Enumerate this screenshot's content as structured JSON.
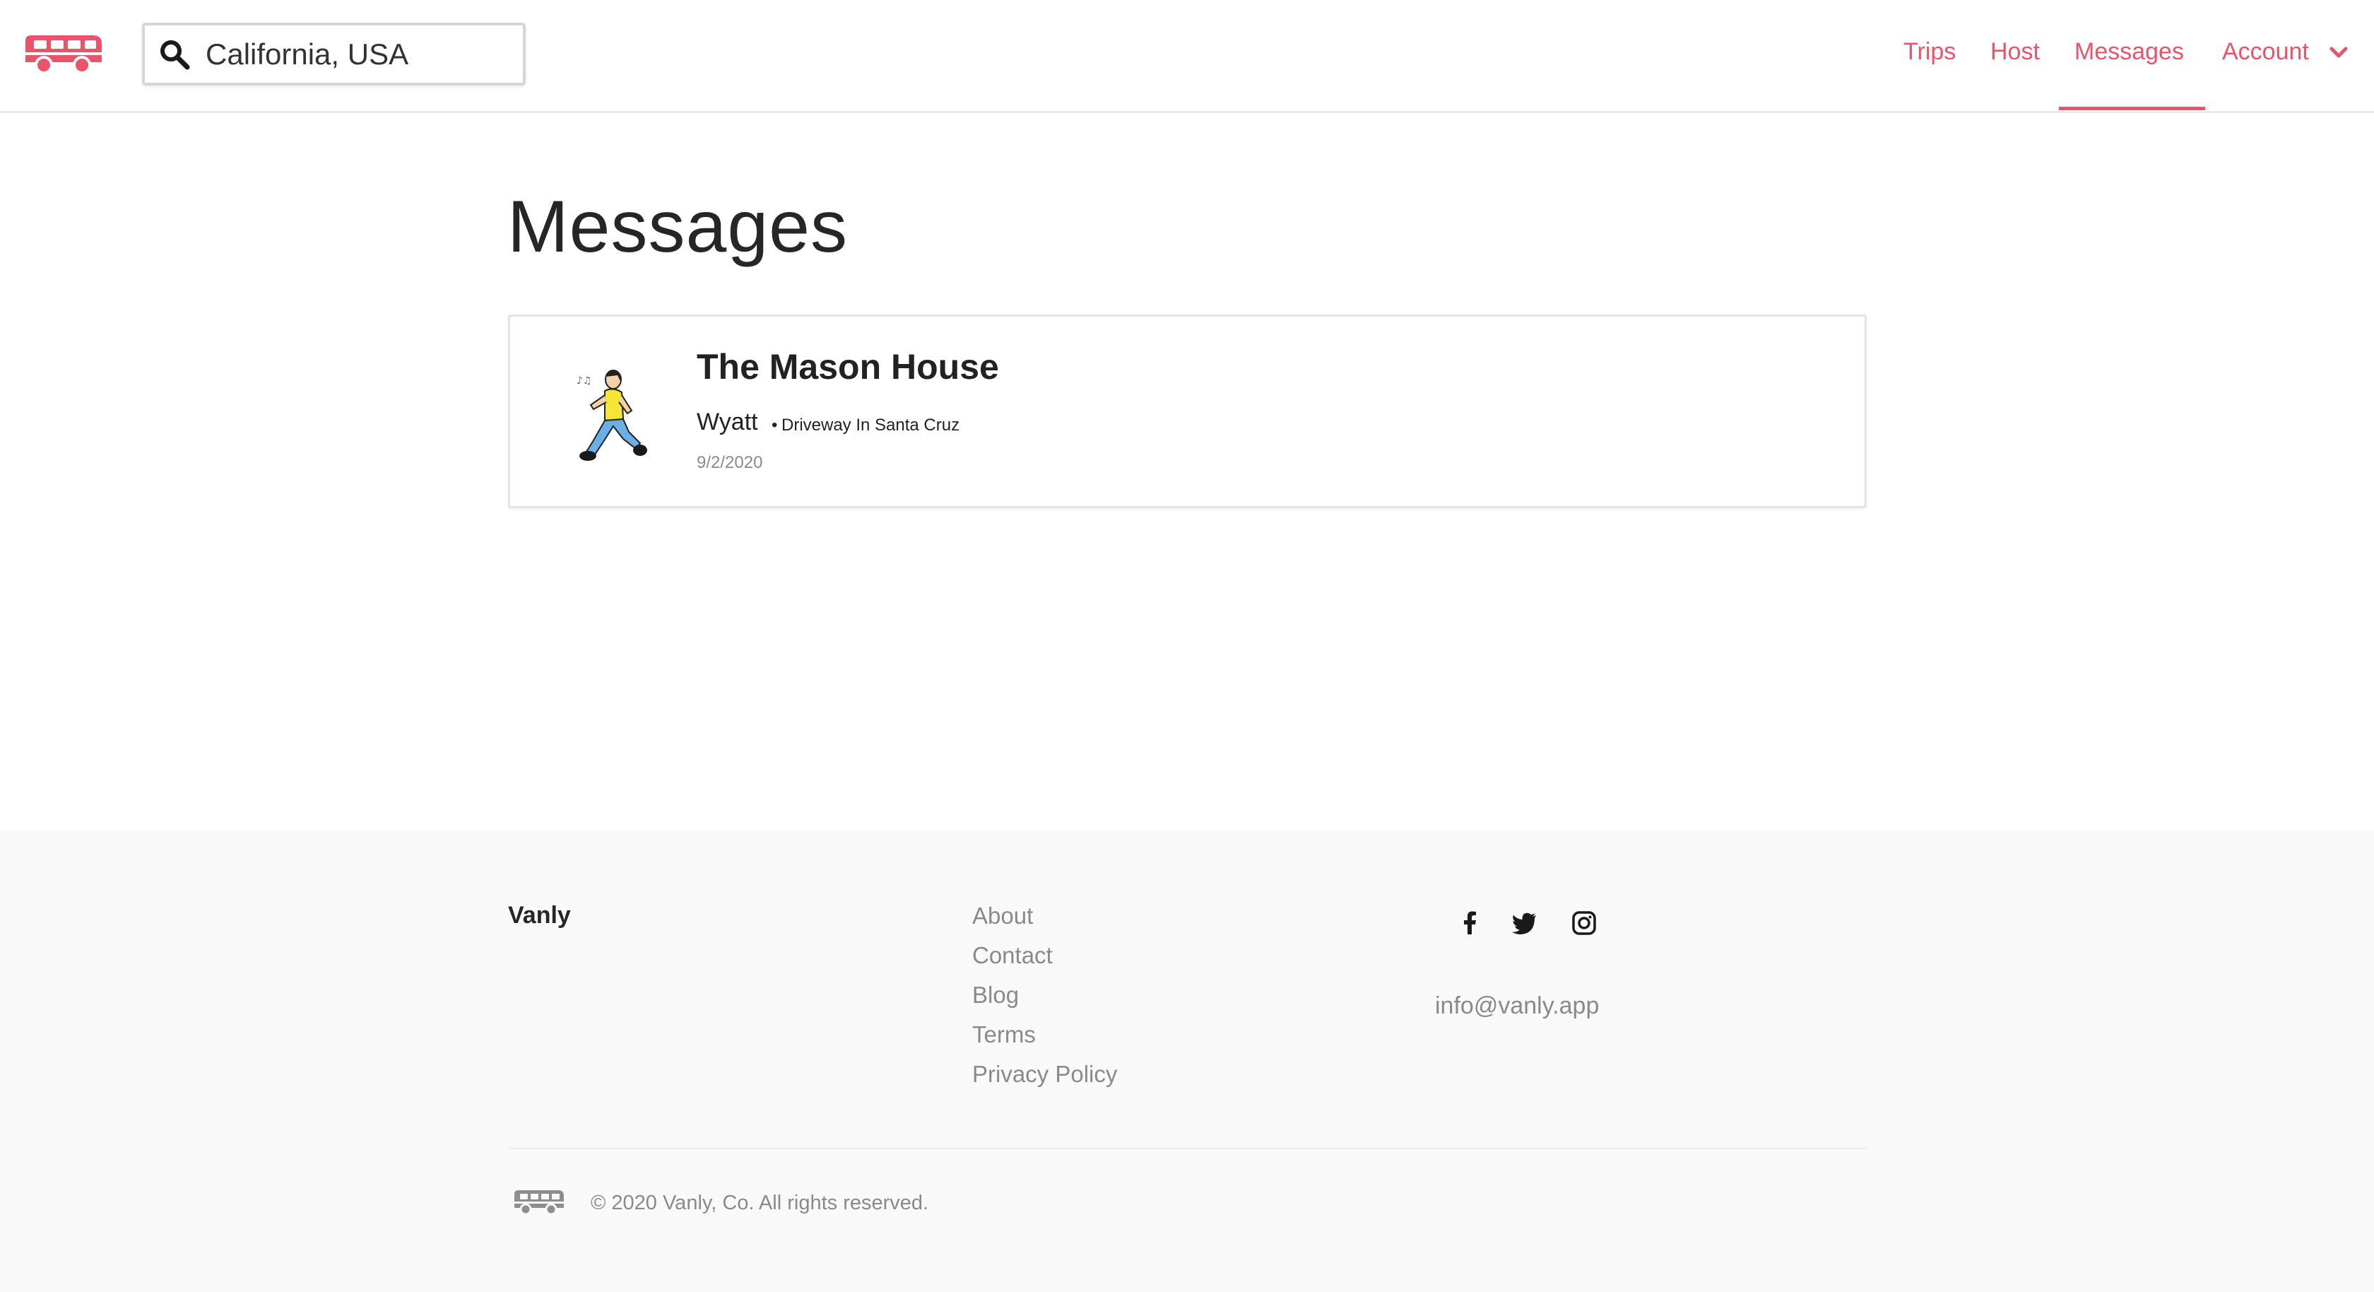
{
  "header": {
    "search": {
      "value": "California, USA",
      "placeholder": ""
    },
    "nav": {
      "trips": "Trips",
      "host": "Host",
      "messages": "Messages",
      "account": "Account",
      "active": "messages"
    },
    "brand_color": "#e8546a"
  },
  "main": {
    "title": "Messages",
    "conversations": [
      {
        "title": "The Mason House",
        "host": "Wyatt",
        "separator": "•",
        "listing": "Driveway In Santa Cruz",
        "date": "9/2/2020"
      }
    ]
  },
  "footer": {
    "brand": "Vanly",
    "links": [
      "About",
      "Contact",
      "Blog",
      "Terms",
      "Privacy Policy"
    ],
    "social": [
      "facebook-icon",
      "twitter-icon",
      "instagram-icon"
    ],
    "email": "info@vanly.app",
    "copyright": "© 2020 Vanly, Co. All rights reserved."
  }
}
